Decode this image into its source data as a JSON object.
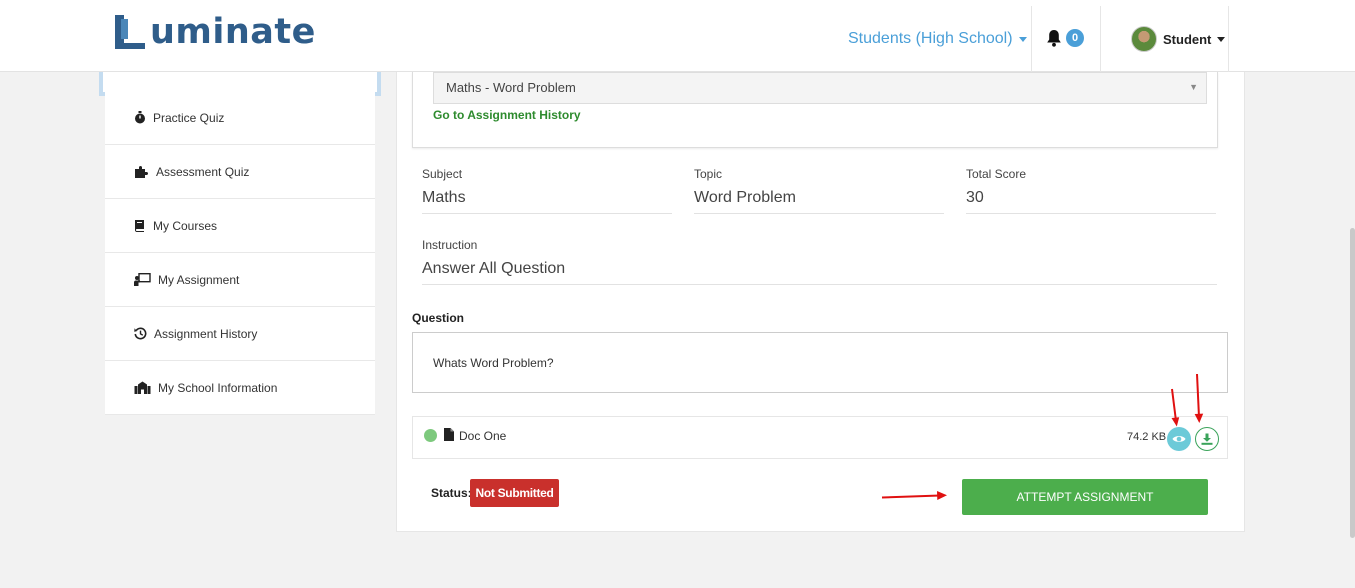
{
  "header": {
    "brand": "uminate",
    "role_selector": "Students (High School)",
    "notification_count": "0",
    "user_name": "Student"
  },
  "sidebar": {
    "items": [
      {
        "label": "Practice Quiz",
        "icon": "stopwatch-icon"
      },
      {
        "label": "Assessment Quiz",
        "icon": "puzzle-icon"
      },
      {
        "label": "My Courses",
        "icon": "book-icon"
      },
      {
        "label": "My Assignment",
        "icon": "chalkboard-teacher-icon"
      },
      {
        "label": "Assignment History",
        "icon": "history-icon"
      },
      {
        "label": "My School Information",
        "icon": "school-icon"
      }
    ]
  },
  "main": {
    "assignment_select": "Maths - Word Problem",
    "history_link": "Go to Assignment History",
    "subject_label": "Subject",
    "subject_value": "Maths",
    "topic_label": "Topic",
    "topic_value": "Word Problem",
    "score_label": "Total Score",
    "score_value": "30",
    "instruction_label": "Instruction",
    "instruction_value": "Answer All Question",
    "question_title": "Question",
    "question_text": "Whats Word Problem?",
    "document": {
      "name": "Doc One",
      "size": "74.2 KB"
    },
    "status_label": "Status:",
    "status_value": "Not Submitted",
    "attempt_button": "ATTEMPT ASSIGNMENT"
  },
  "colors": {
    "brand": "#2f5d8a",
    "accent": "#4a9fd8",
    "success": "#4cae4c",
    "danger": "#c9302c",
    "annotation_arrow": "#e01010"
  }
}
